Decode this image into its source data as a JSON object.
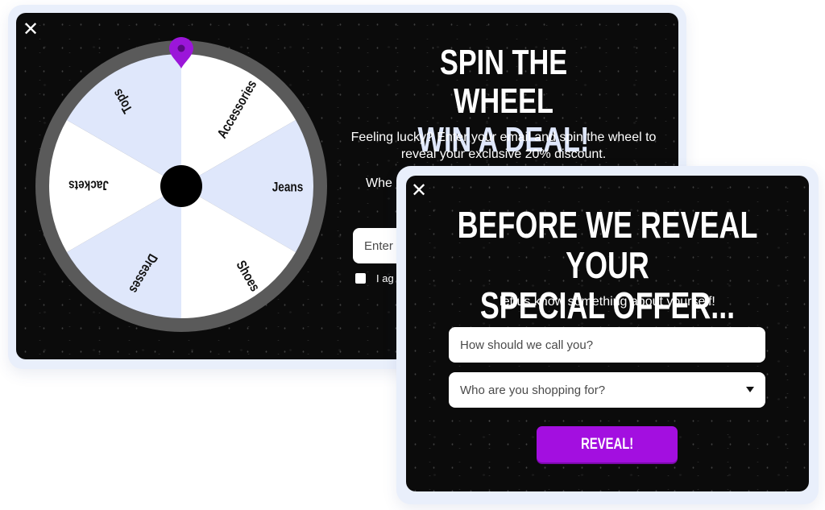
{
  "wheel_popup": {
    "close_glyph": "✕",
    "title_line1": "SPIN THE WHEEL",
    "title_line2": "WIN A DEAL!",
    "description": "Feeling lucky? Enter your email and spin the wheel to reveal your exclusive 20% discount.",
    "partial_text": "Whe",
    "email_placeholder_visible": "Enter",
    "consent_text_visible": "I ag",
    "consent_checked": false,
    "segments": [
      "Accessories",
      "Jeans",
      "Shoes",
      "Dresses",
      "Jackets",
      "Tops"
    ],
    "pointer_icon": "map-pin-icon",
    "colors": {
      "pointer": "#9b16d9",
      "segment_a": "#ffffff",
      "segment_b": "#dfe7fb",
      "rim": "#5a5a5a",
      "hub": "#000000"
    }
  },
  "reveal_popup": {
    "close_glyph": "✕",
    "title_line1": "BEFORE WE REVEAL YOUR",
    "title_line2": "SPECIAL OFFER...",
    "subtitle": "let us know something about yourself!",
    "name_placeholder": "How should we call you?",
    "shopping_select_value": "Who are you shopping for?",
    "dropdown_icon": "caret-down-icon",
    "reveal_button_label": "REVEAL!",
    "colors": {
      "button": "#a30fe0"
    }
  }
}
